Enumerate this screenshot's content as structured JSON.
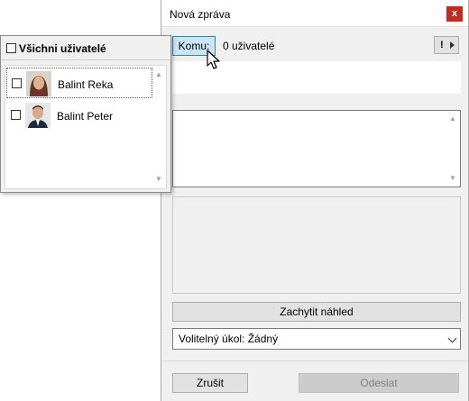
{
  "dialog": {
    "title": "Nová zpráva",
    "close_label": "x",
    "to_button": "Komu:",
    "recipients_count": "0 uživatelé",
    "alert_label": "!",
    "capture_button": "Zachytit náhled",
    "optional_task": "Volitelný úkol: Žádný",
    "cancel_button": "Zrušit",
    "send_button": "Odeslat"
  },
  "user_popup": {
    "select_all_label": "Všichni uživatelé",
    "users": [
      {
        "name": "Balint Reka",
        "checked": false,
        "avatar": "woman-portrait"
      },
      {
        "name": "Balint Peter",
        "checked": false,
        "avatar": "man-portrait"
      }
    ]
  },
  "icons": {
    "close": "close-icon",
    "alert": "exclamation-icon",
    "dropdown": "chevron-down-icon",
    "scroll_up": "scroll-up-icon",
    "scroll_down": "scroll-down-icon",
    "cursor": "mouse-pointer-icon"
  },
  "colors": {
    "close_button": "#c42b1c",
    "to_button_bg": "#cce4f7",
    "to_button_border": "#3c7fb1",
    "dialog_bg": "#f0f0f0",
    "disabled_text": "#838383"
  }
}
